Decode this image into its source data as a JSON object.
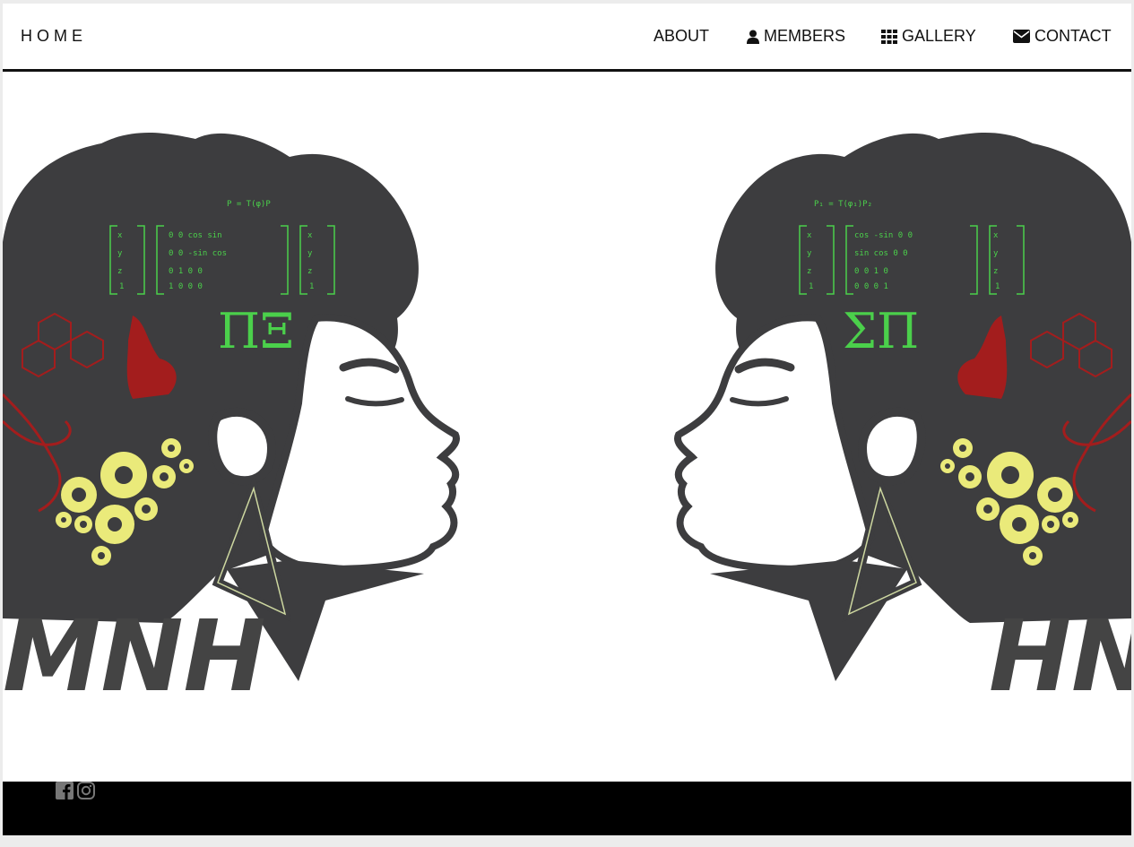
{
  "nav": {
    "brand": "HOME",
    "items": [
      {
        "label": "ABOUT",
        "icon": "none"
      },
      {
        "label": "MEMBERS",
        "icon": "user-icon"
      },
      {
        "label": "GALLERY",
        "icon": "grid-icon"
      },
      {
        "label": "CONTACT",
        "icon": "envelope-icon"
      }
    ]
  },
  "hero": {
    "left_symbol": "ΠΞ",
    "right_symbol": "ΣΠ",
    "left_scrawl": "MNH",
    "right_scrawl": "HNM",
    "equation_left": "P = T(φ)P",
    "equation_right": "P₁ = T(φ₁)P₂",
    "colors": {
      "hair": "#3d3d3f",
      "equations": "#4bd04b",
      "gears": "#eaea7a",
      "accent_red": "#a31d1d"
    }
  },
  "footer": {
    "social": [
      "facebook-icon",
      "instagram-icon"
    ],
    "background": "#000000"
  }
}
